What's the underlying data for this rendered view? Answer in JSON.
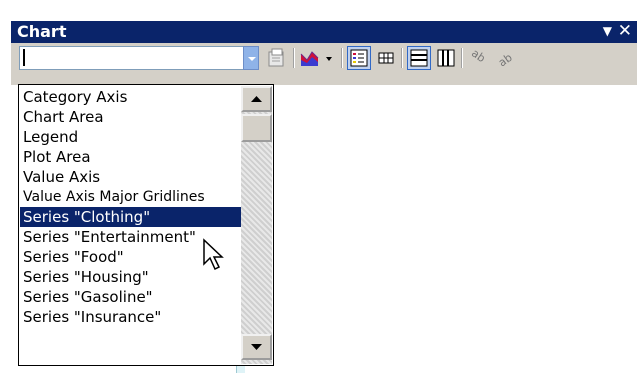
{
  "window": {
    "title": "Chart"
  },
  "combo": {
    "value": ""
  },
  "toolbar": {
    "buttons": [
      {
        "name": "format-selected-object-button",
        "icon": "format-icon"
      },
      {
        "name": "chart-type-button",
        "icon": "area-chart-icon"
      },
      {
        "name": "legend-button",
        "icon": "legend-icon"
      },
      {
        "name": "data-table-button",
        "icon": "data-table-icon"
      },
      {
        "name": "by-row-button",
        "icon": "by-row-icon"
      },
      {
        "name": "by-column-button",
        "icon": "by-column-icon"
      },
      {
        "name": "angle-text-downward-button",
        "icon": "angle-down-icon"
      },
      {
        "name": "angle-text-upward-button",
        "icon": "angle-up-icon"
      }
    ]
  },
  "list": {
    "items": [
      "Category Axis",
      "Chart Area",
      "Legend",
      "Plot Area",
      "Value Axis",
      "Value Axis Major Gridlines",
      "Series \"Clothing\"",
      "Series \"Entertainment\"",
      "Series \"Food\"",
      "Series \"Housing\"",
      "Series \"Gasoline\"",
      "Series \"Insurance\""
    ],
    "selected_index": 6
  },
  "colors": {
    "title_bar": "#0a246a",
    "selection": "#0a246a",
    "toolbar_bg": "#d4d0c8"
  }
}
